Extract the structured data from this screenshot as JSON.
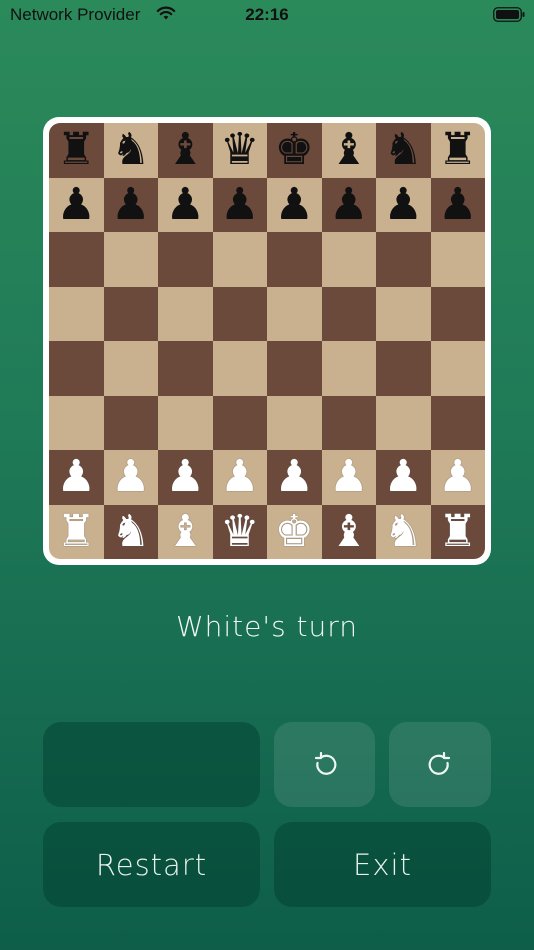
{
  "status_bar": {
    "carrier": "Network Provider",
    "time": "22:16"
  },
  "board": {
    "rows": [
      [
        {
          "g": "♜",
          "c": "black"
        },
        {
          "g": "♞",
          "c": "black"
        },
        {
          "g": "♝",
          "c": "black"
        },
        {
          "g": "♛",
          "c": "black"
        },
        {
          "g": "♚",
          "c": "black"
        },
        {
          "g": "♝",
          "c": "black"
        },
        {
          "g": "♞",
          "c": "black"
        },
        {
          "g": "♜",
          "c": "black"
        }
      ],
      [
        {
          "g": "♟",
          "c": "black"
        },
        {
          "g": "♟",
          "c": "black"
        },
        {
          "g": "♟",
          "c": "black"
        },
        {
          "g": "♟",
          "c": "black"
        },
        {
          "g": "♟",
          "c": "black"
        },
        {
          "g": "♟",
          "c": "black"
        },
        {
          "g": "♟",
          "c": "black"
        },
        {
          "g": "♟",
          "c": "black"
        }
      ],
      [
        null,
        null,
        null,
        null,
        null,
        null,
        null,
        null
      ],
      [
        null,
        null,
        null,
        null,
        null,
        null,
        null,
        null
      ],
      [
        null,
        null,
        null,
        null,
        null,
        null,
        null,
        null
      ],
      [
        null,
        null,
        null,
        null,
        null,
        null,
        null,
        null
      ],
      [
        {
          "g": "♟",
          "c": "white"
        },
        {
          "g": "♟",
          "c": "white"
        },
        {
          "g": "♟",
          "c": "white"
        },
        {
          "g": "♟",
          "c": "white"
        },
        {
          "g": "♟",
          "c": "white"
        },
        {
          "g": "♟",
          "c": "white"
        },
        {
          "g": "♟",
          "c": "white"
        },
        {
          "g": "♟",
          "c": "white"
        }
      ],
      [
        {
          "g": "♜",
          "c": "white"
        },
        {
          "g": "♞",
          "c": "white"
        },
        {
          "g": "♝",
          "c": "white"
        },
        {
          "g": "♛",
          "c": "white"
        },
        {
          "g": "♚",
          "c": "white"
        },
        {
          "g": "♝",
          "c": "white"
        },
        {
          "g": "♞",
          "c": "white"
        },
        {
          "g": "♜",
          "c": "white"
        }
      ]
    ],
    "piece_names": {
      "♜": "rook",
      "♞": "knight",
      "♝": "bishop",
      "♛": "queen",
      "♚": "king",
      "♟": "pawn"
    },
    "colors": {
      "light": "#c9b08e",
      "dark": "#6b4a3c"
    }
  },
  "turn_label": "White's turn",
  "controls": {
    "undo_icon": "undo-icon",
    "redo_icon": "redo-icon",
    "restart_label": "Restart",
    "exit_label": "Exit"
  }
}
